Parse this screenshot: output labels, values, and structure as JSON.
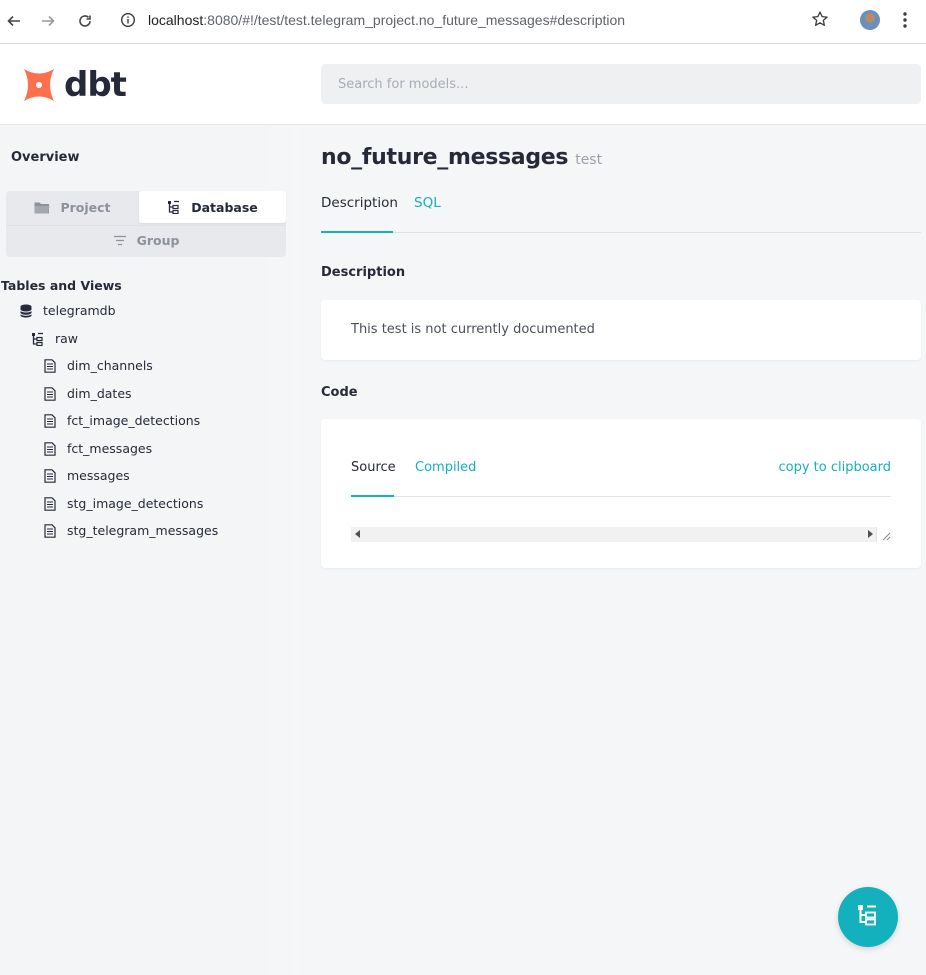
{
  "browser": {
    "url_host": "localhost",
    "url_rest": ":8080/#!/test/test.telegram_project.no_future_messages#description"
  },
  "header": {
    "logo_text": "dbt",
    "search_placeholder": "Search for models..."
  },
  "sidebar": {
    "overview_label": "Overview",
    "switcher": {
      "project_label": "Project",
      "database_label": "Database",
      "group_label": "Group",
      "active": "Database"
    },
    "tables_title": "Tables and Views",
    "database": "telegramdb",
    "schema": "raw",
    "tables": [
      "dim_channels",
      "dim_dates",
      "fct_image_detections",
      "fct_messages",
      "messages",
      "stg_image_detections",
      "stg_telegram_messages"
    ]
  },
  "main": {
    "title": "no_future_messages",
    "resource_type": "test",
    "tabs": [
      "Description",
      "SQL"
    ],
    "active_tab": "Description",
    "description_section_title": "Description",
    "description_text": "This test is not currently documented",
    "code_section_title": "Code",
    "code_tabs": [
      "Source",
      "Compiled"
    ],
    "active_code_tab": "Source",
    "copy_label": "copy to clipboard"
  },
  "colors": {
    "accent": "#13b1bd",
    "logo": "#fe6f4d",
    "text": "#262a38"
  }
}
